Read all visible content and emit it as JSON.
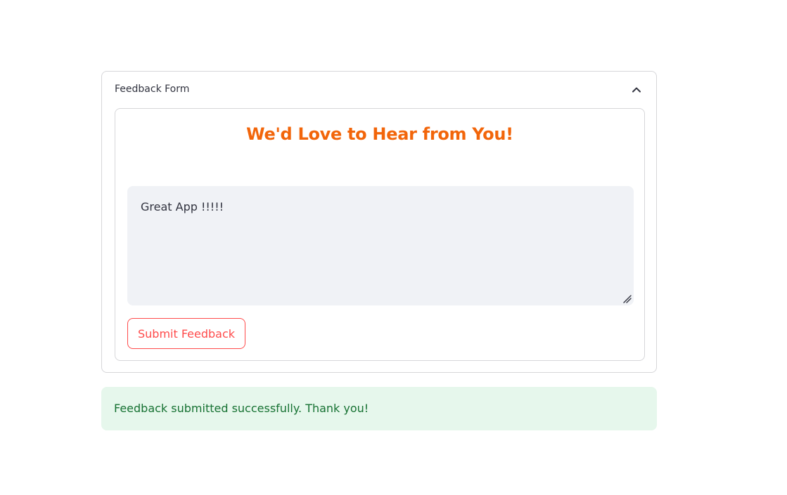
{
  "expander": {
    "title": "Feedback Form",
    "expanded": true
  },
  "form": {
    "heading": "We'd Love to Hear from You!",
    "feedback_value": "Great App !!!!!",
    "submit_label": "Submit Feedback"
  },
  "alert": {
    "message": "Feedback submitted successfully. Thank you!",
    "type": "success"
  },
  "colors": {
    "heading": "#f2650a",
    "primary": "#ff4b4b",
    "success_bg": "#e6f7ec",
    "success_text": "#177233"
  },
  "icons": {
    "toggle": "chevron-up-icon",
    "resize": "resize-handle-icon"
  }
}
